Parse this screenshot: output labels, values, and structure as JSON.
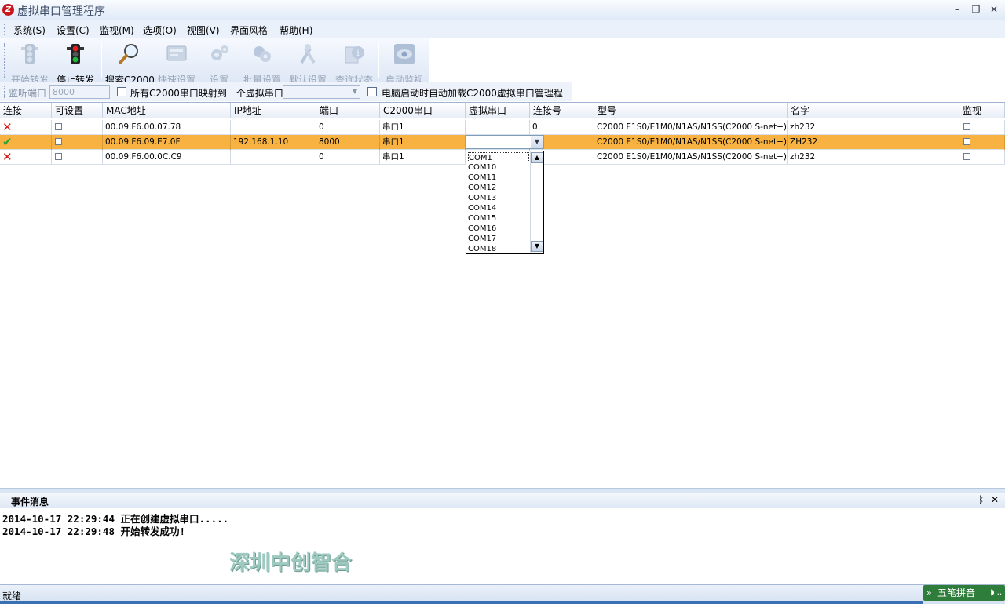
{
  "window": {
    "title": "虚拟串口管理程序",
    "icon_label": "Z",
    "min": "–",
    "restore": "❐",
    "close": "✕"
  },
  "menu": [
    "系统(S)",
    "设置(C)",
    "监视(M)",
    "选项(O)",
    "视图(V)",
    "界面风格",
    "帮助(H)"
  ],
  "toolbar": {
    "start": "开始转发",
    "stop": "停止转发",
    "search": "搜索C2000",
    "quick": "快速设置",
    "settings": "设置",
    "batch": "批量设置",
    "default": "默认设置",
    "query": "查询状态",
    "monitor": "启动监视"
  },
  "options": {
    "listen_label": "监听端口",
    "listen_value": "8000",
    "map_all_label": "所有C2000串口映射到一个虚拟串口",
    "autoload_label": "电脑启动时自动加载C2000虚拟串口管理程序"
  },
  "grid": {
    "headers": [
      "连接",
      "可设置",
      "MAC地址",
      "IP地址",
      "端口",
      "C2000串口",
      "虚拟串口",
      "连接号",
      "型号",
      "名字",
      "监视"
    ],
    "rows": [
      {
        "status": "disconnected",
        "status_glyph": "✕",
        "mac": "00.09.F6.00.07.78",
        "ip": "",
        "port": "0",
        "c2000": "串口1",
        "virtual": "",
        "conn": "0",
        "model": "C2000 E1S0/E1M0/N1AS/N1SS(C2000 S-net+)",
        "name": "zh232"
      },
      {
        "status": "connected",
        "status_glyph": "✔",
        "mac": "00.09.F6.09.E7.0F",
        "ip": "192.168.1.10",
        "port": "8000",
        "c2000": "串口1",
        "virtual": "",
        "conn": "",
        "model": "C2000 E1S0/E1M0/N1AS/N1SS(C2000 S-net+)",
        "name": "ZH232"
      },
      {
        "status": "disconnected",
        "status_glyph": "✕",
        "mac": "00.09.F6.00.0C.C9",
        "ip": "",
        "port": "0",
        "c2000": "串口1",
        "virtual": "",
        "conn": "",
        "model": "C2000 E1S0/E1M0/N1AS/N1SS(C2000 S-net+)",
        "name": "zh232"
      }
    ]
  },
  "dropdown": {
    "items": [
      "COM1",
      "COM10",
      "COM11",
      "COM12",
      "COM13",
      "COM14",
      "COM15",
      "COM16",
      "COM17",
      "COM18"
    ],
    "arrow": "▼",
    "up": "▲",
    "down": "▼"
  },
  "events": {
    "title": "事件消息",
    "pin": "ᛒ",
    "close": "✕",
    "messages": [
      "2014-10-17 22:29:44 正在创建虚拟串口.....",
      "2014-10-17 22:29:48 开始转发成功!"
    ],
    "watermark": "深圳中创智合"
  },
  "status": {
    "text": "就绪",
    "ime": "五笔拼音",
    "ime_icon": "»",
    "ime_extra": "◗ ,,"
  },
  "colors": {
    "selected_row": "#f7b241",
    "error": "#d51a1a",
    "ok": "#2fa32f"
  }
}
